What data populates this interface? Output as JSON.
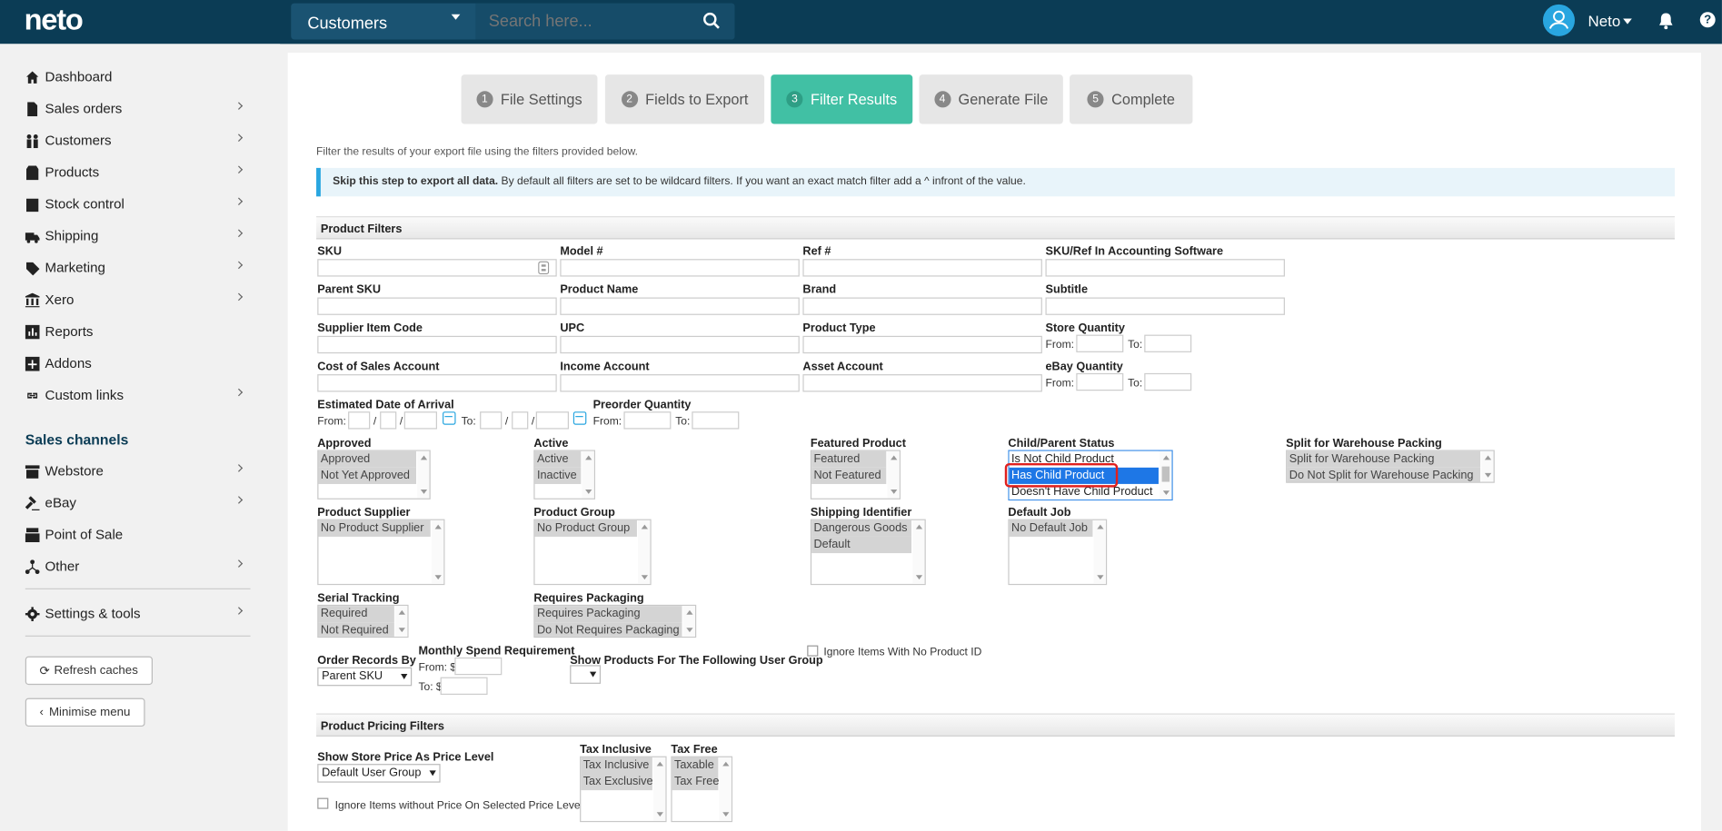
{
  "topbar": {
    "logo": "neto",
    "section_select": "Customers",
    "search_placeholder": "Search here...",
    "user_name": "Neto",
    "help": "?"
  },
  "sidebar": {
    "items": [
      {
        "label": "Dashboard",
        "icon": "home-icon"
      },
      {
        "label": "Sales orders",
        "icon": "document-icon"
      },
      {
        "label": "Customers",
        "icon": "users-icon"
      },
      {
        "label": "Products",
        "icon": "box-icon"
      },
      {
        "label": "Stock control",
        "icon": "checklist-icon"
      },
      {
        "label": "Shipping",
        "icon": "truck-icon"
      },
      {
        "label": "Marketing",
        "icon": "tag-icon"
      },
      {
        "label": "Xero",
        "icon": "bank-icon"
      },
      {
        "label": "Reports",
        "icon": "chart-icon"
      },
      {
        "label": "Addons",
        "icon": "plus-square-icon"
      },
      {
        "label": "Custom links",
        "icon": "link-icon"
      }
    ],
    "sales_channels_title": "Sales channels",
    "channels": [
      {
        "label": "Webstore",
        "icon": "store-icon"
      },
      {
        "label": "eBay",
        "icon": "gavel-icon"
      },
      {
        "label": "Point of Sale",
        "icon": "register-icon"
      },
      {
        "label": "Other",
        "icon": "network-icon"
      }
    ],
    "settings": "Settings & tools",
    "refresh": "Refresh caches",
    "minimise": "Minimise menu"
  },
  "steps": [
    {
      "num": "1",
      "label": "File Settings"
    },
    {
      "num": "2",
      "label": "Fields to Export"
    },
    {
      "num": "3",
      "label": "Filter Results"
    },
    {
      "num": "4",
      "label": "Generate File"
    },
    {
      "num": "5",
      "label": "Complete"
    }
  ],
  "intro": "Filter the results of your export file using the filters provided below.",
  "alert": {
    "bold": "Skip this step to export all data.",
    "text": " By default all filters are set to be wildcard filters. If you want an exact match filter add a ^ infront of the value."
  },
  "product_filters": {
    "title": "Product Filters",
    "sku": "SKU",
    "model": "Model #",
    "ref": "Ref #",
    "sku_ref": "SKU/Ref In Accounting Software",
    "parent_sku": "Parent SKU",
    "product_name": "Product Name",
    "brand": "Brand",
    "subtitle": "Subtitle",
    "supplier_item_code": "Supplier Item Code",
    "upc": "UPC",
    "product_type": "Product Type",
    "store_quantity": "Store Quantity",
    "cost_of_sales": "Cost of Sales Account",
    "income_account": "Income Account",
    "asset_account": "Asset Account",
    "ebay_quantity": "eBay Quantity",
    "from": "From:",
    "to": "To:",
    "slash": "/",
    "eta": "Estimated Date of Arrival",
    "preorder": "Preorder Quantity",
    "approved": {
      "label": "Approved",
      "options": [
        "Approved",
        "Not Yet Approved"
      ]
    },
    "active": {
      "label": "Active",
      "options": [
        "Active",
        "Inactive"
      ]
    },
    "featured": {
      "label": "Featured Product",
      "options": [
        "Featured",
        "Not Featured"
      ]
    },
    "child_parent": {
      "label": "Child/Parent Status",
      "options": [
        "Is Not Child Product",
        "Has Child Product",
        "Doesn't Have Child Product"
      ]
    },
    "split": {
      "label": "Split for Warehouse Packing",
      "options": [
        "Split for Warehouse Packing",
        "Do Not Split for Warehouse Packing"
      ]
    },
    "supplier": {
      "label": "Product Supplier",
      "options": [
        "No Product Supplier"
      ]
    },
    "group": {
      "label": "Product Group",
      "options": [
        "No Product Group"
      ]
    },
    "shipping_id": {
      "label": "Shipping Identifier",
      "options": [
        "Dangerous Goods",
        "Default"
      ]
    },
    "default_job": {
      "label": "Default Job",
      "options": [
        "No Default Job"
      ]
    },
    "serial": {
      "label": "Serial Tracking",
      "options": [
        "Required",
        "Not Required"
      ]
    },
    "packaging": {
      "label": "Requires Packaging",
      "options": [
        "Requires Packaging",
        "Do Not Requires Packaging"
      ]
    },
    "order_by": {
      "label": "Order Records By",
      "value": "Parent SKU"
    },
    "monthly": {
      "label": "Monthly Spend Requirement",
      "from": "From: $",
      "to": "To: $"
    },
    "user_group": {
      "label": "Show Products For The Following User Group"
    },
    "ignore_no_id": "Ignore Items With No Product ID"
  },
  "pricing_filters": {
    "title": "Product Pricing Filters",
    "price_level": {
      "label": "Show Store Price As Price Level",
      "value": "Default User Group"
    },
    "tax_inclusive": {
      "label": "Tax Inclusive",
      "options": [
        "Tax Inclusive",
        "Tax Exclusive"
      ]
    },
    "tax_free": {
      "label": "Tax Free",
      "options": [
        "Taxable",
        "Tax Free"
      ]
    },
    "ignore_no_price": "Ignore Items without Price On Selected Price Level"
  }
}
